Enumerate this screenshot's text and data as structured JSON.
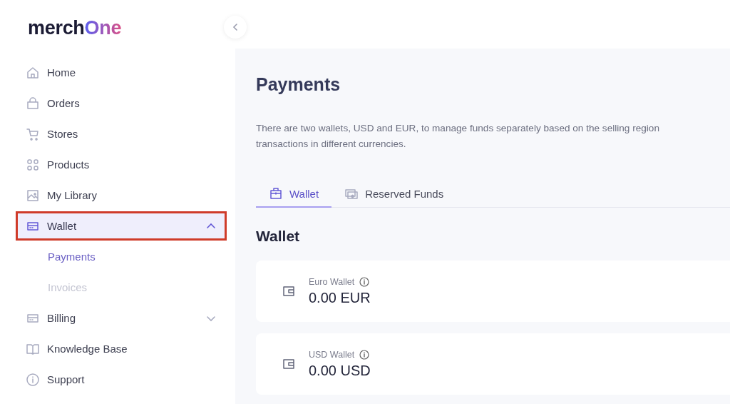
{
  "logo": {
    "part_1": "merch",
    "part_2": "One"
  },
  "sidebar": {
    "items": [
      {
        "label": "Home",
        "kind": "home",
        "selected": false
      },
      {
        "label": "Orders",
        "kind": "bag",
        "selected": false
      },
      {
        "label": "Stores",
        "kind": "cart",
        "selected": false
      },
      {
        "label": "Products",
        "kind": "grid",
        "selected": false
      },
      {
        "label": "My Library",
        "kind": "image",
        "selected": false
      },
      {
        "label": "Wallet",
        "kind": "card",
        "selected": true,
        "expanded": true,
        "highlighted": true,
        "children": [
          {
            "label": "Payments",
            "selected": true,
            "disabled": false
          },
          {
            "label": "Invoices",
            "selected": false,
            "disabled": true
          }
        ]
      },
      {
        "label": "Billing",
        "kind": "card",
        "selected": false,
        "expanded": false,
        "highlighted": false
      },
      {
        "label": "Knowledge Base",
        "kind": "book",
        "selected": false
      },
      {
        "label": "Support",
        "kind": "info",
        "selected": false
      }
    ]
  },
  "page": {
    "title": "Payments",
    "description": [
      "There are two wallets, USD and EUR, to manage funds separately based on the selling region",
      "transactions in different currencies."
    ],
    "tabs": [
      {
        "label": "Wallet",
        "kind": "briefcase",
        "selected": true
      },
      {
        "label": "Reserved Funds",
        "kind": "cash",
        "selected": false
      }
    ],
    "section_title": "Wallet",
    "wallets": [
      {
        "name": "Euro Wallet",
        "amount": "0.00 EUR"
      },
      {
        "name": "USD Wallet",
        "amount": "0.00 USD"
      }
    ]
  }
}
